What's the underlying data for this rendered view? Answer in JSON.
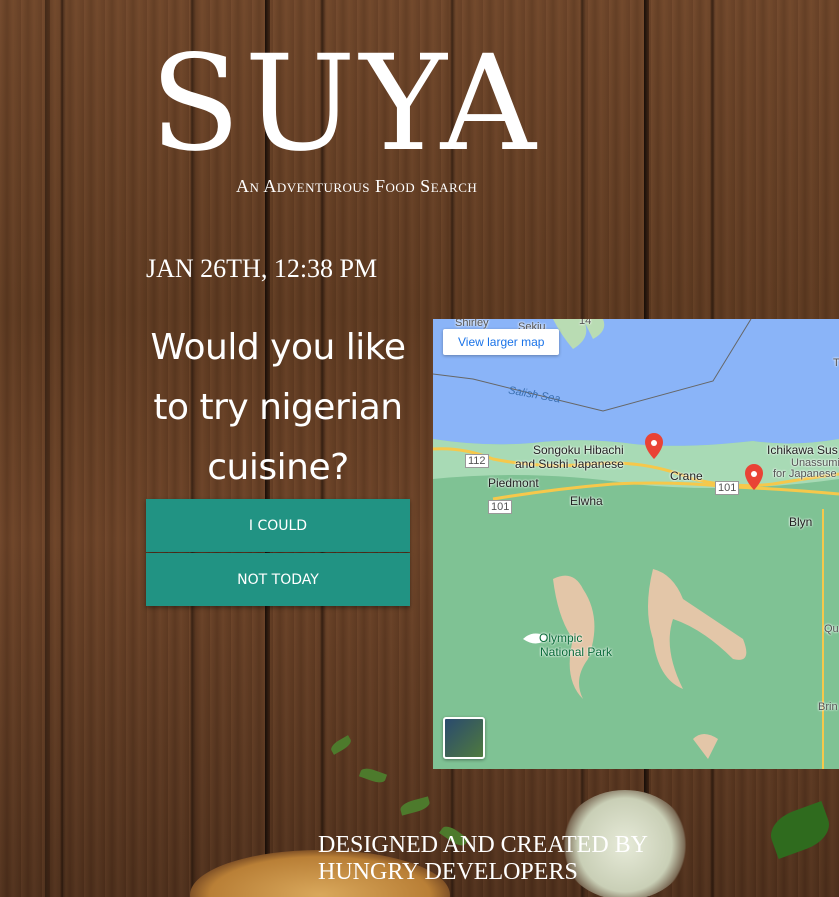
{
  "brand": {
    "title": "SUYA",
    "tagline": "An Adventurous Food Search"
  },
  "datetime": "JAN 26TH, 12:38 PM",
  "prompt": {
    "question": "Would you like to try nigerian cuisine?"
  },
  "actions": {
    "accept_label": "I COULD",
    "decline_label": "NOT TODAY",
    "button_color": "#219383"
  },
  "map": {
    "view_larger_label": "View larger map",
    "labels": {
      "shirley": "Shirley",
      "sekiu": "Sekiu",
      "salish_sea": "Salish Sea",
      "songoku": "Songoku Hibachi",
      "songoku2": "and Sushi Japanese",
      "ichikawa": "Ichikawa Sus",
      "ichikawa2": "Unassumin",
      "ichikawa3": "for Japanese",
      "piedmont": "Piedmont",
      "elwha": "Elwha",
      "crane": "Crane",
      "blyn": "Blyn",
      "park1": "Olympic",
      "park2": "National Park",
      "route_112": "112",
      "route_101a": "101",
      "route_101b": "101",
      "route_14": "14",
      "edge_t": "T",
      "edge_qu": "Qu",
      "edge_brin": "Brin"
    }
  },
  "footer": {
    "line1": "DESIGNED AND CREATED BY",
    "line2": "HUNGRY DEVELOPERS"
  }
}
